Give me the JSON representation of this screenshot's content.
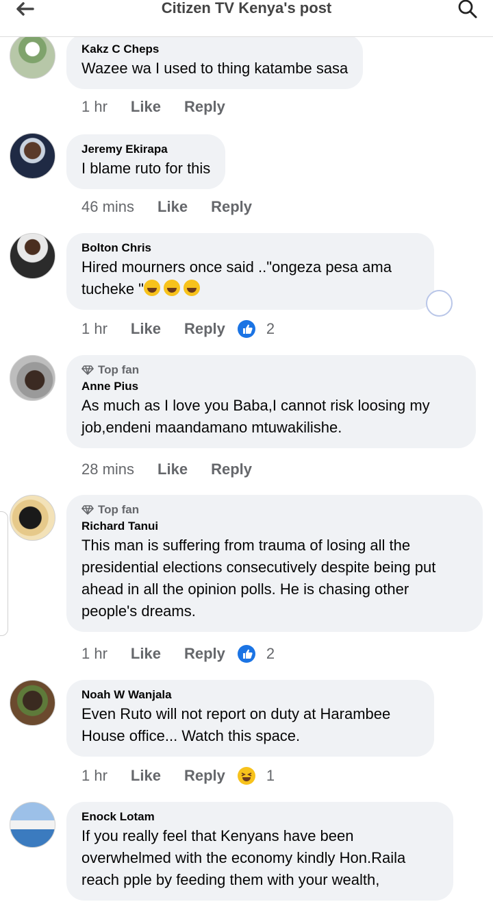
{
  "header": {
    "title": "Citizen TV Kenya's post"
  },
  "icons": {
    "back": "arrow-left-icon",
    "search": "search-icon",
    "top_fan": "diamond-icon",
    "like_reaction": "thumbs-up-icon",
    "haha_reaction": "laughing-face-icon"
  },
  "colors": {
    "bubble": "#f0f2f5",
    "muted_text": "#65676b",
    "like_blue": "#1b74e4",
    "emoji_yellow": "#f7c21c"
  },
  "actions": {
    "like": "Like",
    "reply": "Reply"
  },
  "comments": [
    {
      "author": "Kakz C Cheps",
      "text": "Wazee wa I used to thing katambe sasa",
      "time": "1 hr"
    },
    {
      "author": "Jeremy Ekirapa",
      "text": "I blame ruto for this",
      "time": "46 mins"
    },
    {
      "author": "Bolton Chris",
      "text": "Hired mourners once said ..\"ongeza pesa ama tucheke \"",
      "time": "1 hr",
      "reaction": "like",
      "reaction_count": "2"
    },
    {
      "badge": "Top fan",
      "author": "Anne Pius",
      "text": "As much as I love you Baba,I cannot risk loosing my job,endeni maandamano mtuwakilishe.",
      "time": "28 mins"
    },
    {
      "badge": "Top fan",
      "author": "Richard Tanui",
      "text": "This man is suffering from trauma of losing all the presidential elections consecutively despite being put ahead in all the opinion polls. He is chasing other people's dreams.",
      "time": "1 hr",
      "reaction": "like",
      "reaction_count": "2"
    },
    {
      "author": "Noah W Wanjala",
      "text": "Even Ruto will not report on duty at Harambee House office... Watch this space.",
      "time": "1 hr",
      "reaction": "haha",
      "reaction_count": "1"
    },
    {
      "author": "Enock Lotam",
      "text": "If you really feel that Kenyans have been overwhelmed with the economy kindly Hon.Raila reach pple by feeding them with your wealth,"
    }
  ]
}
